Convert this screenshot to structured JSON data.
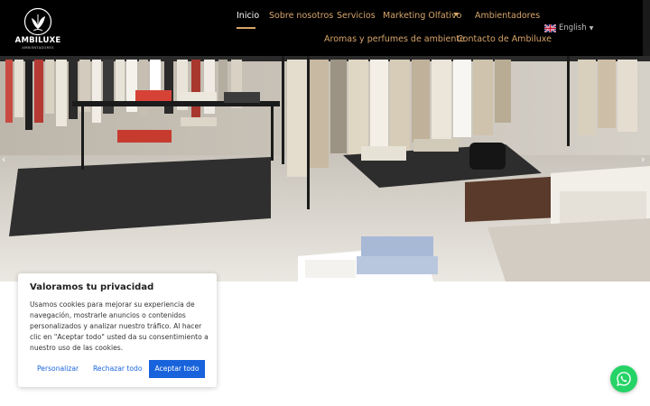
{
  "brand": {
    "name": "AMBILUXE",
    "tagline": "AMBIENTADORES"
  },
  "nav": {
    "items": [
      {
        "label": "Inicio",
        "active": true
      },
      {
        "label": "Sobre nosotros"
      },
      {
        "label": "Servicios"
      },
      {
        "label": "Marketing Olfativo",
        "has_dropdown": true
      },
      {
        "label": "Ambientadores"
      },
      {
        "label": "Aromas y perfumes de ambiente"
      },
      {
        "label": "Contacto de Ambiluxe"
      }
    ],
    "language": {
      "label": "English",
      "flag": "uk-flag-icon"
    }
  },
  "hero": {
    "image": "clothing-store-interior",
    "prev_arrow": "‹",
    "next_arrow": "›"
  },
  "cookie_banner": {
    "title": "Valoramos tu privacidad",
    "text": "Usamos cookies para mejorar su experiencia de navegación, mostrarle anuncios o contenidos personalizados y analizar nuestro tráfico. Al hacer clic en \"Aceptar todo\" usted da su consentimiento a nuestro uso de las cookies.",
    "customize_label": "Personalizar",
    "reject_label": "Rechazar todo",
    "accept_label": "Aceptar todo"
  },
  "whatsapp": {
    "icon": "whatsapp-icon"
  },
  "colors": {
    "header_bg": "#000000",
    "nav_link": "#d7a56a",
    "nav_active": "#ffffff",
    "cookie_accent": "#1863dc",
    "whatsapp": "#25d366"
  }
}
